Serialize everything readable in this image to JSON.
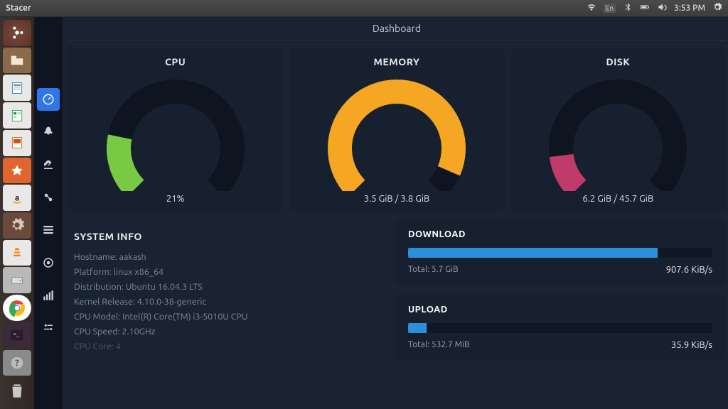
{
  "topbar": {
    "title": "Stacer",
    "language": "En",
    "clock": "3:53 PM"
  },
  "page": {
    "title": "Dashboard"
  },
  "gauges": {
    "cpu": {
      "title": "CPU",
      "value_text": "21%",
      "percent": 21,
      "color": "#7ac943"
    },
    "memory": {
      "title": "MEMORY",
      "value_text": "3.5 GiB / 3.8 GiB",
      "percent": 92,
      "color": "#f5a623"
    },
    "disk": {
      "title": "DISK",
      "value_text": "6.2 GiB / 45.7 GiB",
      "percent": 14,
      "color": "#c03a6a"
    }
  },
  "sysinfo": {
    "heading": "SYSTEM INFO",
    "rows": [
      "Hostname: aakash",
      "Platform: linux x86_64",
      "Distribution: Ubuntu 16.04.3 LTS",
      "Kernel Release: 4.10.0-38-generic",
      "CPU Model: Intel(R) Core(TM) i3-5010U CPU",
      "CPU Speed: 2.10GHz",
      "CPU Core: 4"
    ]
  },
  "network": {
    "download": {
      "title": "DOWNLOAD",
      "total_label": "Total: 5.7 GiB",
      "rate": "907.6 KiB/s",
      "percent": 82
    },
    "upload": {
      "title": "UPLOAD",
      "total_label": "Total: 532.7 MiB",
      "rate": "35.9 KiB/s",
      "percent": 6
    }
  },
  "chart_data": [
    {
      "type": "gauge",
      "name": "CPU",
      "value": 21,
      "max": 100,
      "unit": "%",
      "display": "21%"
    },
    {
      "type": "gauge",
      "name": "MEMORY",
      "value": 3.5,
      "max": 3.8,
      "unit": "GiB",
      "display": "3.5 GiB / 3.8 GiB"
    },
    {
      "type": "gauge",
      "name": "DISK",
      "value": 6.2,
      "max": 45.7,
      "unit": "GiB",
      "display": "6.2 GiB / 45.7 GiB"
    },
    {
      "type": "bar",
      "name": "DOWNLOAD",
      "total_gib": 5.7,
      "rate_kibs": 907.6
    },
    {
      "type": "bar",
      "name": "UPLOAD",
      "total_mib": 532.7,
      "rate_kibs": 35.9
    }
  ]
}
